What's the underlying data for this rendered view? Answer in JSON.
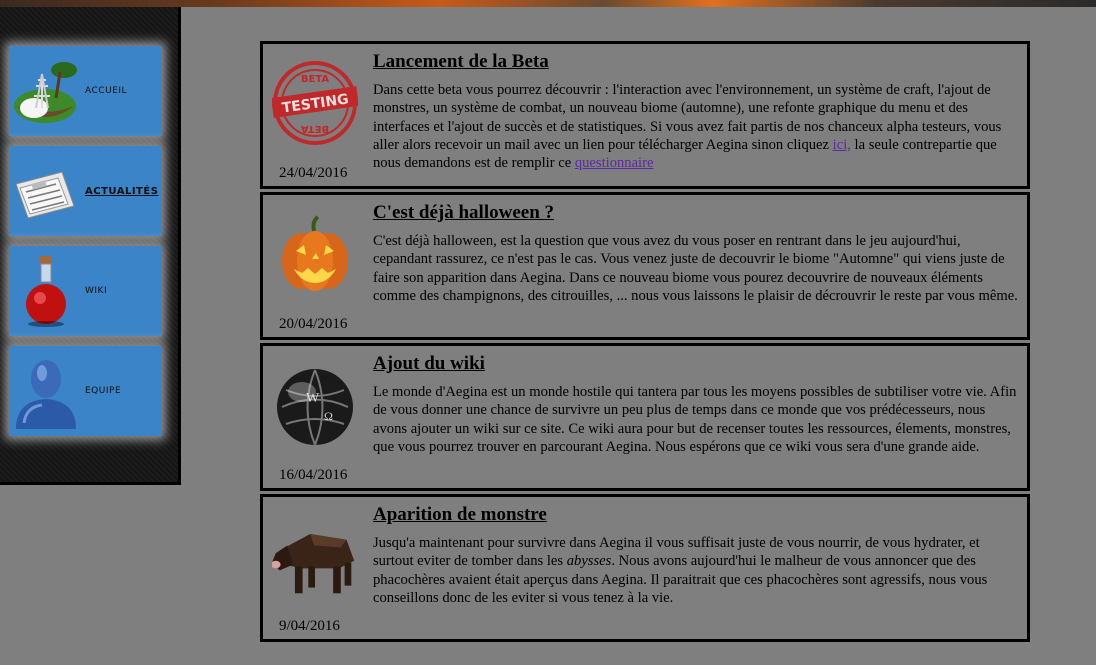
{
  "nav": {
    "items": [
      {
        "label": "ACCUEIL",
        "icon": "island-icon"
      },
      {
        "label": "ACTUALITÉS",
        "icon": "newspaper-icon"
      },
      {
        "label": "WIKI",
        "icon": "potion-icon"
      },
      {
        "label": "EQUIPE",
        "icon": "user-icon"
      }
    ]
  },
  "articles": [
    {
      "title": "Lancement de la Beta",
      "date": "24/04/2016",
      "icon": "beta-testing-stamp-icon",
      "stamp_top": "BETA",
      "stamp_mid": "TESTING",
      "stamp_bot": "BETA",
      "body_1": "Dans cette beta vous pourrez découvrir : l'interaction avec l'environnement, un système de craft, l'ajout de monstres, un système de combat, un nouveau biome (automne), une refonte graphique du menu et des interfaces et l'ajout de succès et de statistiques. Si vous avez fait partis de nos chanceux alpha testeurs, vous aller alors recevoir un mail avec un lien pour télécharger Aegina sinon cliquez ",
      "link_1": "ici,",
      "body_2": " la seule contrepartie que nous demandons est de remplir ce ",
      "link_2": "questionnaire"
    },
    {
      "title": "C'est déjà halloween ?",
      "date": "20/04/2016",
      "icon": "pumpkin-icon",
      "body": "C'est déjà halloween, est la question que vous avez du vous poser en rentrant dans le jeu aujourd'hui, cepandant rassurez, ce n'est pas le cas. Vous venez juste de decouvrir le biome \"Automne\" qui viens juste de faire son apparition dans Aegina. Dans ce nouveau biome vous pourez decouvrire de nouveaux éléments comme des champignons, des citrouilles, ... nous vous laissons le plaisir de décrouvrir le reste par vous même."
    },
    {
      "title": "Ajout du wiki",
      "date": "16/04/2016",
      "icon": "wikipedia-globe-icon",
      "body": "Le monde d'Aegina est un monde hostile qui tantera par tous les moyens possibles de subtiliser votre vie. Afin de vous donner une chance de survivre un peu plus de temps dans ce monde que vos prédécesseurs, nous avons ajouter un wiki sur ce site. Ce wiki aura pour but de recenser toutes les ressources, élements, monstres, que vous pourrez trouver en parcourant Aegina. Nous espérons que ce wiki vous sera d'une grande aide."
    },
    {
      "title": "Aparition de monstre",
      "date": "9/04/2016",
      "icon": "boar-icon",
      "body_1": "Jusqu'a maintenant pour survivre dans Aegina il vous suffisait juste de vous nourrir, de vous hydrater, et surtout eviter de tomber dans les ",
      "body_em": "abysses",
      "body_2": ". Nous avons aujourd'hui le malheur de vous annoncer que des phacochères avaient était aperçus dans Aegina. Il paraitrait que ces phacochères sont agressifs, nous vous conseillons donc de les eviter si vous tenez à la vie."
    }
  ]
}
